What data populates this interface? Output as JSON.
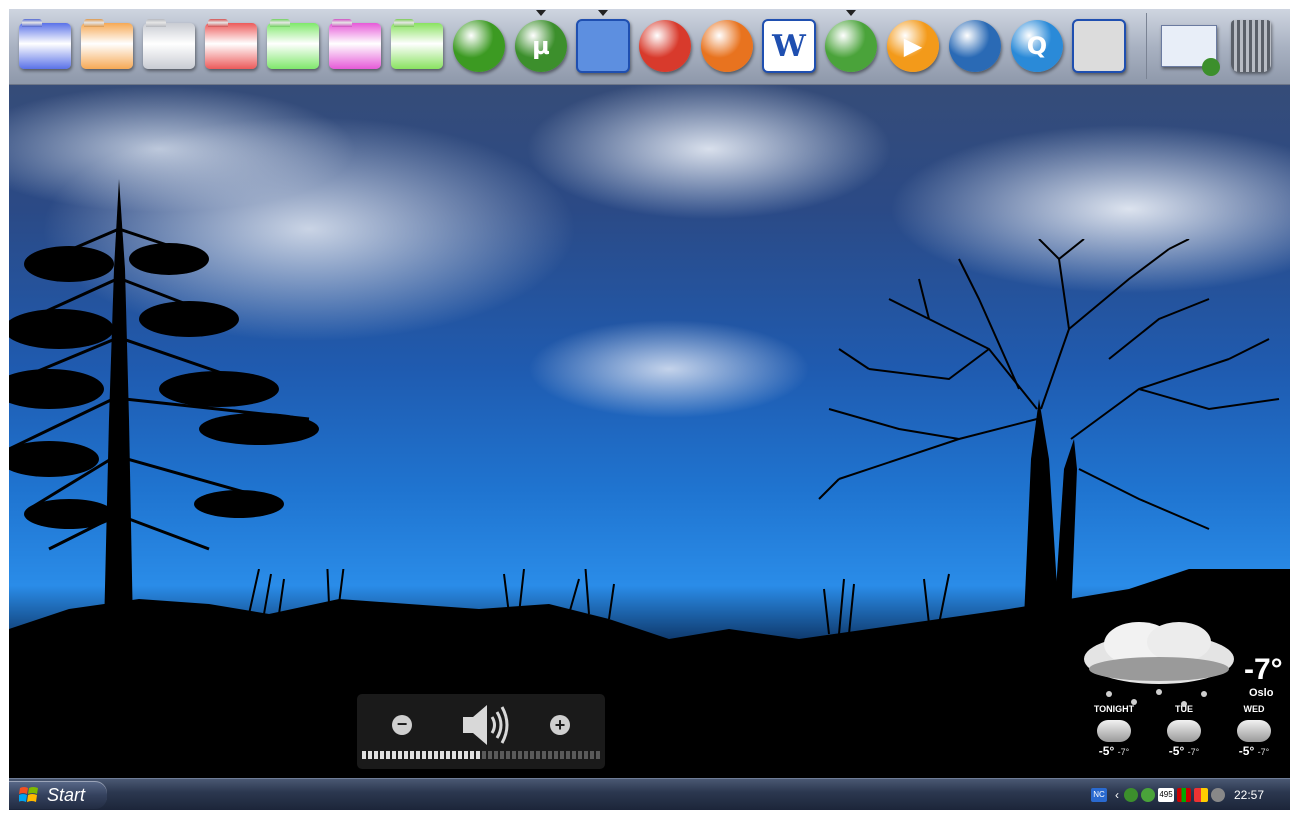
{
  "dock": {
    "items": [
      {
        "name": "blue-folder-icon",
        "kind": "folder",
        "color": "#5a72e8"
      },
      {
        "name": "orange-folder-icon",
        "kind": "folder",
        "color": "#f6a955"
      },
      {
        "name": "gray-folder-icon",
        "kind": "folder",
        "color": "#c9ccd3"
      },
      {
        "name": "red-folder-icon",
        "kind": "folder",
        "color": "#ec5a5a"
      },
      {
        "name": "green-folder-icon",
        "kind": "folder",
        "color": "#7fe86b"
      },
      {
        "name": "pink-folder-icon",
        "kind": "folder",
        "color": "#e65ad8"
      },
      {
        "name": "lightgreen-folder-icon",
        "kind": "folder",
        "color": "#89e260"
      },
      {
        "name": "limewire-icon",
        "kind": "round",
        "color": "#3c9a22"
      },
      {
        "name": "utorrent-icon",
        "kind": "round",
        "color": "#3c8f2c",
        "glyph": "µ",
        "running": true
      },
      {
        "name": "finder-icon",
        "kind": "square",
        "color": "#5d8fe0",
        "running": true
      },
      {
        "name": "ccleaner-icon",
        "kind": "round",
        "color": "#d83a2c"
      },
      {
        "name": "firefox-icon",
        "kind": "round",
        "color": "#e8731f"
      },
      {
        "name": "word-icon",
        "kind": "square",
        "color": "#ffffff",
        "glyph": "W"
      },
      {
        "name": "messenger-icon",
        "kind": "round",
        "color": "#4aa33a",
        "running": true
      },
      {
        "name": "media-player-icon",
        "kind": "round",
        "color": "#f39a1a",
        "glyph": "▶"
      },
      {
        "name": "dvd-player-icon",
        "kind": "round",
        "color": "#2a6ab5"
      },
      {
        "name": "quicktime-icon",
        "kind": "round",
        "color": "#2a8ad8",
        "glyph": "Q"
      },
      {
        "name": "boot-camp-icon",
        "kind": "square",
        "color": "#dcdcdc"
      },
      {
        "name": "utorrent-window-icon",
        "kind": "window",
        "color": "#e8eef8"
      },
      {
        "name": "trash-icon",
        "kind": "trash",
        "color": "#8a8f98"
      }
    ]
  },
  "volume": {
    "level": 0.5,
    "segments": 40,
    "minus": "−",
    "plus": "+"
  },
  "weather": {
    "temperature": "-7°",
    "city": "Oslo",
    "forecast": [
      {
        "day": "TONIGHT",
        "high": "-5°",
        "low": "-7°"
      },
      {
        "day": "TUE",
        "high": "-5°",
        "low": "-7°"
      },
      {
        "day": "WED",
        "high": "-5°",
        "low": "-7°"
      }
    ]
  },
  "taskbar": {
    "start_label": "Start",
    "tray_label": "NC",
    "tray_counter": "495",
    "clock": "22:57"
  }
}
